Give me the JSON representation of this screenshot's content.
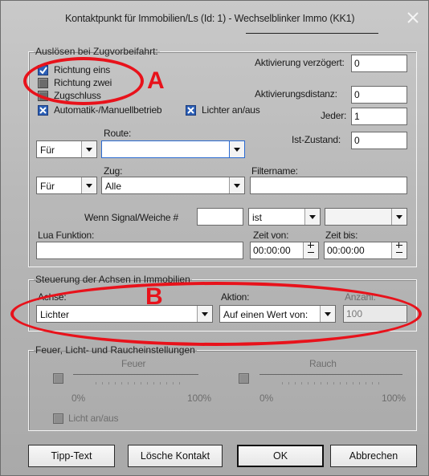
{
  "window": {
    "title": "Kontaktpunkt für Immobilien/Ls (Id: 1) - Wechselblinker Immo (KK1)"
  },
  "trigger_group": {
    "legend": "Auslösen bei Zugvorbeifahrt:",
    "checkboxes": [
      {
        "label": "Richtung eins",
        "checked": true
      },
      {
        "label": "Richtung zwei",
        "checked": false
      },
      {
        "label": "Zugschluss",
        "checked": false
      },
      {
        "label": "Automatik-/Manuellbetrieb",
        "checked": true
      },
      {
        "label": "Lichter an/aus",
        "checked": true
      }
    ],
    "aktivierung_verzoegert": {
      "label": "Aktivierung verzögert:",
      "value": "0"
    },
    "aktivierungsdistanz": {
      "label": "Aktivierungsdistanz:",
      "value": "0"
    },
    "jeder": {
      "label": "Jeder:",
      "value": "1"
    },
    "ist_zustand": {
      "label": "Ist-Zustand:",
      "value": "0"
    },
    "route": {
      "label": "Route:",
      "for_value": "Für",
      "value": ""
    },
    "zug": {
      "label": "Zug:",
      "for_value": "Für",
      "value": "Alle"
    },
    "filtername": {
      "label": "Filtername:",
      "value": ""
    },
    "signal": {
      "label": "Wenn Signal/Weiche #",
      "value": "",
      "op_value": "ist",
      "state_value": ""
    },
    "lua": {
      "label": "Lua Funktion:",
      "value": ""
    },
    "zeit_von": {
      "label": "Zeit von:",
      "value": "00:00:00"
    },
    "zeit_bis": {
      "label": "Zeit bis:",
      "value": "00:00:00"
    }
  },
  "axes_group": {
    "legend": "Steuerung der Achsen in Immobilien",
    "achse": {
      "label": "Achse:",
      "value": "Lichter"
    },
    "aktion": {
      "label": "Aktion:",
      "value": "Auf einen Wert von:"
    },
    "anzahl": {
      "label": "Anzahl:",
      "value": "100"
    }
  },
  "fire_group": {
    "legend": "Feuer, Licht- und Raucheinstellungen",
    "feuer": {
      "label": "Feuer",
      "min": "0%",
      "max": "100%"
    },
    "rauch": {
      "label": "Rauch",
      "min": "0%",
      "max": "100%"
    },
    "licht": {
      "label": "Licht an/aus"
    }
  },
  "buttons": {
    "tipp_text": "Tipp-Text",
    "loesche_kontakt": "Lösche Kontakt",
    "ok": "OK",
    "abbrechen": "Abbrechen"
  },
  "annotations": {
    "a": "A",
    "b": "B",
    "color": "#e8121b"
  }
}
